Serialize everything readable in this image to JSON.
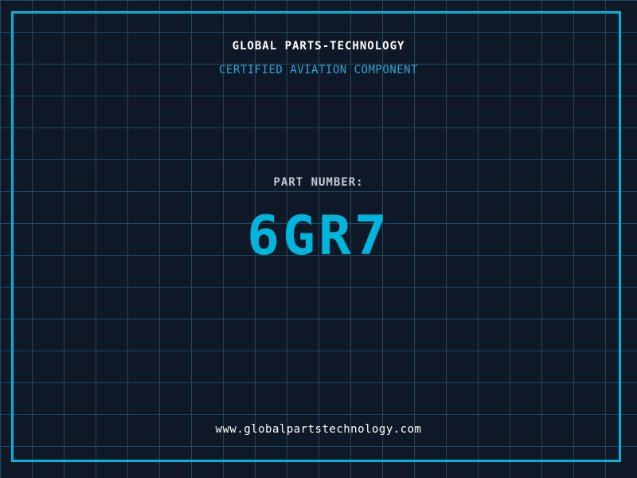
{
  "page": {
    "title": "GLOBAL PARTS-TECHNOLOGY",
    "subtitle": "CERTIFIED AVIATION COMPONENT",
    "part_label": "PART NUMBER:",
    "part_number": "6GR7",
    "website": "www.globalpartstechnology.com"
  },
  "colors": {
    "background": "#0f1826",
    "grid_line": "#1c4a60",
    "accent_cyan": "#00b4db",
    "subtitle_cyan": "#2ea4d2",
    "label_gray": "#c2c8d6",
    "text_white": "#ffffff"
  }
}
